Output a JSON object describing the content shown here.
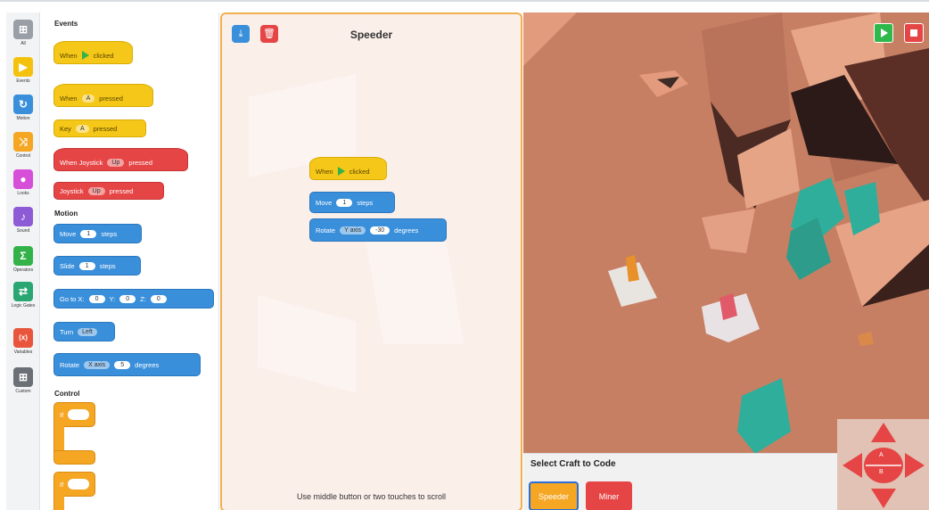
{
  "rail": {
    "items": [
      {
        "label": "All",
        "icon": "grid-icon",
        "color": "#9a9ea6"
      },
      {
        "label": "Events",
        "icon": "play-icon",
        "color": "#f4c20d"
      },
      {
        "label": "Motion",
        "icon": "rotate-icon",
        "color": "#3a8fdb"
      },
      {
        "label": "Control",
        "icon": "shuffle-icon",
        "color": "#f5a623"
      },
      {
        "label": "Looks",
        "icon": "drop-icon",
        "color": "#d64fd8"
      },
      {
        "label": "Sound",
        "icon": "music-note-icon",
        "color": "#8e5bd6"
      },
      {
        "label": "Operators",
        "icon": "sigma-icon",
        "color": "#34b24a"
      },
      {
        "label": "Logic Gates",
        "icon": "logic-icon",
        "color": "#2aa673"
      },
      {
        "label": "Variables",
        "icon": "variable-icon",
        "color": "#e8553c"
      },
      {
        "label": "Custom",
        "icon": "blocks-icon",
        "color": "#6b6f76"
      }
    ],
    "glyphs": [
      "⊞",
      "▶",
      "↻",
      "⤨",
      "●",
      "♪",
      "Σ",
      "⇄",
      "(x)",
      "⊞"
    ]
  },
  "palette": {
    "events_title": "Events",
    "motion_title": "Motion",
    "control_title": "Control",
    "when": "When",
    "clicked": "clicked",
    "pressed": "pressed",
    "key": "Key",
    "when_joystick": "When Joystick",
    "joystick": "Joystick",
    "key_value": "A",
    "joy_value": "Up",
    "move": "Move",
    "steps": "steps",
    "slide": "Slide",
    "one": "1",
    "goto_x": "Go to X:",
    "y_label": "Y:",
    "z_label": "Z:",
    "zero": "0",
    "turn": "Turn",
    "left": "Left",
    "rotate": "Rotate",
    "x_axis": "X axis",
    "five": "5",
    "degrees": "degrees",
    "if": "If"
  },
  "workspace": {
    "title": "Speeder",
    "hint": "Use middle button or two touches to scroll",
    "script": {
      "when": "When",
      "clicked": "clicked",
      "move": "Move",
      "move_value": "1",
      "steps": "steps",
      "rotate": "Rotate",
      "axis": "Y axis",
      "angle": "-30",
      "degrees": "degrees"
    }
  },
  "selector": {
    "title": "Select Craft to Code",
    "crafts": [
      "Speeder",
      "Miner"
    ]
  },
  "dpad": {
    "a": "A",
    "b": "B"
  },
  "colors": {
    "accent": "#f5a623",
    "workspace_border": "#f0b050",
    "terrain": "#c77f63"
  }
}
